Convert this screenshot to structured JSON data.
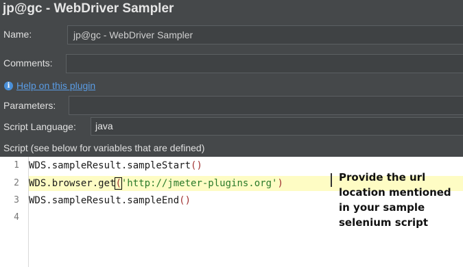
{
  "window": {
    "title": "jp@gc - WebDriver Sampler"
  },
  "form": {
    "name_label": "Name:",
    "name_value": "jp@gc - WebDriver Sampler",
    "comments_label": "Comments:",
    "comments_value": "",
    "help_link": "Help on this plugin",
    "parameters_label": "Parameters:",
    "parameters_value": "",
    "script_language_label": "Script Language:",
    "script_language_value": "java",
    "script_label": "Script (see below for variables that are defined)"
  },
  "editor": {
    "line_numbers": [
      "1",
      "2",
      "3",
      "4"
    ],
    "lines": {
      "l1_code": "WDS.sampleResult.sampleStart",
      "l1_paren": "()",
      "l2_code": "WDS.browser.get",
      "l2_open": "(",
      "l2_string": "'http://jmeter-plugins.org'",
      "l2_close": ")",
      "l3_code": "WDS.sampleResult.sampleEnd",
      "l3_paren": "()"
    }
  },
  "annotation": {
    "text": "Provide the url location mentioned in your sample selenium script"
  }
}
